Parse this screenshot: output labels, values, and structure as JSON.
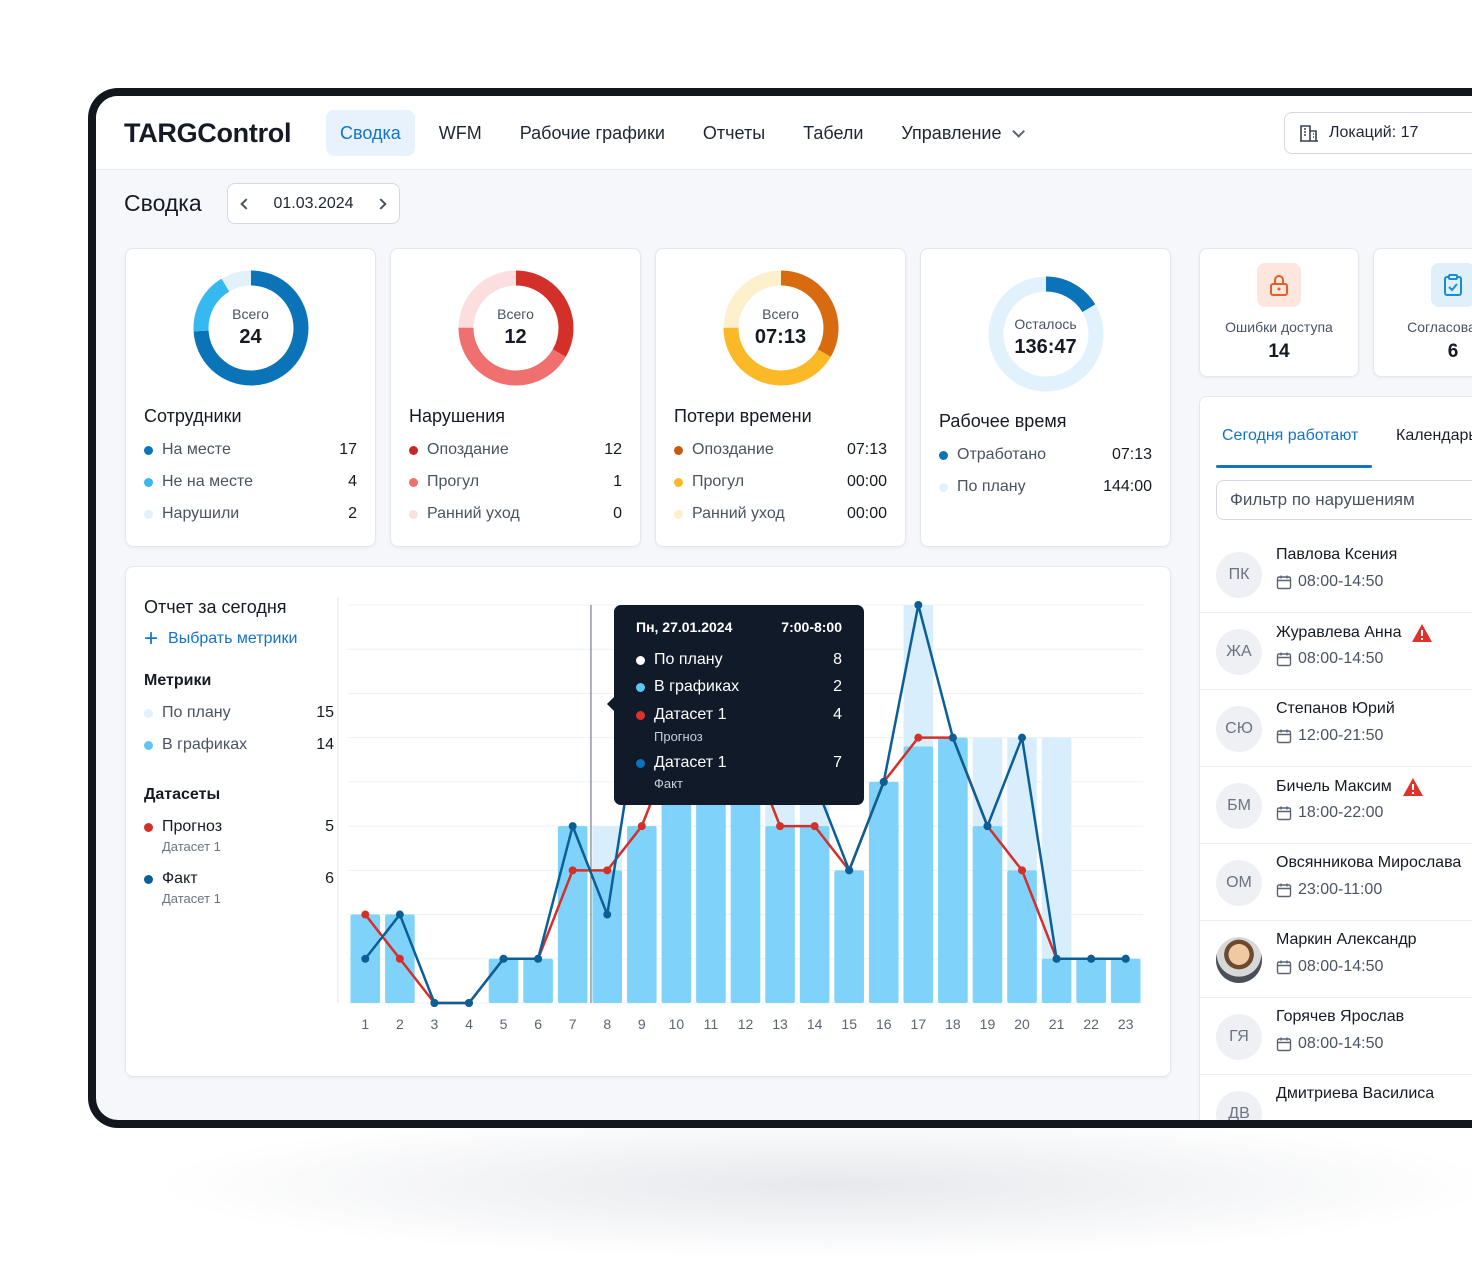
{
  "app": {
    "logo": "TARGControl"
  },
  "nav": [
    {
      "label": "Сводка",
      "active": true
    },
    {
      "label": "WFM"
    },
    {
      "label": "Рабочие графики"
    },
    {
      "label": "Отчеты"
    },
    {
      "label": "Табели"
    },
    {
      "label": "Управление",
      "dropdown": true
    }
  ],
  "location": {
    "label": "Локаций: 17",
    "icon": "building-icon"
  },
  "page": {
    "title": "Сводка",
    "date": "01.03.2024"
  },
  "cards": [
    {
      "title": "Сотрудники",
      "donut_caption": "Всего",
      "donut_value": "24",
      "segments": [
        {
          "value": 17,
          "color": "#0b73b8"
        },
        {
          "value": 4,
          "color": "#36b8f0"
        },
        {
          "value": 2,
          "color": "#e2f2fc"
        }
      ],
      "rows": [
        {
          "label": "На месте",
          "value": "17",
          "color": "#0b73b8"
        },
        {
          "label": "Не на месте",
          "value": "4",
          "color": "#36b8f0"
        },
        {
          "label": "Нарушили",
          "value": "2",
          "color": "#e2f2fc"
        }
      ]
    },
    {
      "title": "Нарушения",
      "donut_caption": "Всего",
      "donut_value": "12",
      "segments": [
        {
          "value": 4,
          "color": "#d4302a"
        },
        {
          "value": 5,
          "color": "#f07070"
        },
        {
          "value": 3,
          "color": "#fcdede"
        }
      ],
      "rows": [
        {
          "label": "Опоздание",
          "value": "12",
          "color": "#c42a24"
        },
        {
          "label": "Прогул",
          "value": "1",
          "color": "#f07070"
        },
        {
          "label": "Ранний уход",
          "value": "0",
          "color": "#fbe0e0"
        }
      ]
    },
    {
      "title": "Потери времени",
      "donut_caption": "Всего",
      "donut_value": "07:13",
      "segments": [
        {
          "value": 4,
          "color": "#d86a10"
        },
        {
          "value": 5,
          "color": "#fbb928"
        },
        {
          "value": 3,
          "color": "#fdf0cc"
        }
      ],
      "rows": [
        {
          "label": "Опоздание",
          "value": "07:13",
          "color": "#c85a0e"
        },
        {
          "label": "Прогул",
          "value": "00:00",
          "color": "#fbb928"
        },
        {
          "label": "Ранний уход",
          "value": "00:00",
          "color": "#fdf0c8"
        }
      ]
    },
    {
      "title": "Рабочее время",
      "donut_caption": "Осталось",
      "donut_value": "136:47",
      "segments": [
        {
          "value": 7.2,
          "color": "#0b73b8"
        },
        {
          "value": 36.8,
          "color": "#e2f2fc"
        }
      ],
      "rows": [
        {
          "label": "Отработано",
          "value": "07:13",
          "color": "#0b73b8"
        },
        {
          "label": "По плану",
          "value": "144:00",
          "color": "#e2f2fc"
        }
      ]
    }
  ],
  "mini_cards": [
    {
      "label": "Ошибки доступа",
      "value": "14",
      "icon": "lock-icon",
      "bg": "#fde6de",
      "fg": "#e0602a"
    },
    {
      "label": "Согласования",
      "value": "6",
      "icon": "clipboard-check-icon",
      "bg": "#dff0fb",
      "fg": "#1a8fd0"
    }
  ],
  "report": {
    "title": "Отчет за сегодня",
    "add_metrics": "Выбрать метрики",
    "metrics_header": "Метрики",
    "metrics": [
      {
        "label": "По плану",
        "value": "15",
        "color": "#e2f2fc"
      },
      {
        "label": "В графиках",
        "value": "14",
        "color": "#5ec6f4"
      }
    ],
    "datasets_header": "Датасеты",
    "datasets": [
      {
        "label": "Прогноз",
        "sub": "Датасет 1",
        "value": "5",
        "color": "#d4302a"
      },
      {
        "label": "Факт",
        "sub": "Датасет 1",
        "value": "6",
        "color": "#0b5f98"
      }
    ]
  },
  "chart_data": {
    "type": "bar",
    "categories": [
      "1",
      "2",
      "3",
      "4",
      "5",
      "6",
      "7",
      "8",
      "9",
      "10",
      "11",
      "12",
      "13",
      "14",
      "15",
      "16",
      "17",
      "18",
      "19",
      "20",
      "21",
      "22",
      "23"
    ],
    "ylim": [
      0,
      9
    ],
    "grid": true,
    "series": [
      {
        "name": "По плану",
        "type": "bar",
        "color": "#d8eefc",
        "values": [
          2,
          2,
          0,
          0,
          1,
          1,
          4,
          4,
          4,
          5,
          7,
          6,
          6,
          5,
          3,
          5,
          9,
          6,
          6,
          6,
          6,
          1,
          1
        ]
      },
      {
        "name": "В графиках",
        "type": "bar",
        "color": "#7fd3fa",
        "values": [
          2,
          2,
          0,
          0,
          1,
          1,
          4,
          3,
          4,
          6,
          6,
          6,
          4,
          4,
          3,
          5,
          5.8,
          6,
          4,
          3,
          1,
          1,
          1
        ]
      },
      {
        "name": "Прогноз",
        "type": "line",
        "color": "#d4302a",
        "values": [
          2,
          1,
          0,
          0,
          1,
          1,
          3,
          3,
          4,
          6,
          6,
          6,
          4,
          4,
          3,
          5,
          6,
          6,
          4,
          3,
          1,
          1,
          1
        ]
      },
      {
        "name": "Факт",
        "type": "line",
        "color": "#0b5f98",
        "values": [
          1,
          2,
          0,
          0,
          1,
          1,
          4,
          2,
          7,
          6,
          6,
          6,
          5,
          5,
          3,
          5,
          9,
          6,
          4,
          6,
          1,
          1,
          1
        ]
      }
    ]
  },
  "tooltip": {
    "date": "Пн, 27.01.2024",
    "range": "7:00-8:00",
    "rows": [
      {
        "label": "По плану",
        "value": "8",
        "color": "#ffffff"
      },
      {
        "label": "В графиках",
        "value": "2",
        "color": "#5ec6f4"
      },
      {
        "label": "Датасет 1",
        "sub": "Прогноз",
        "value": "4",
        "color": "#e0322b"
      },
      {
        "label": "Датасет 1",
        "sub": "Факт",
        "value": "7",
        "color": "#0b73b8"
      }
    ]
  },
  "tabs": [
    {
      "label": "Сегодня работают",
      "active": true
    },
    {
      "label": "Календарь"
    }
  ],
  "filter_placeholder": "Фильтр по нарушениям",
  "people": [
    {
      "initials": "ПК",
      "name": "Павлова Ксения",
      "time": "08:00-14:50",
      "warning": false
    },
    {
      "initials": "ЖА",
      "name": "Журавлева Анна",
      "time": "08:00-14:50",
      "warning": true
    },
    {
      "initials": "СЮ",
      "name": "Степанов Юрий",
      "time": "12:00-21:50",
      "warning": false
    },
    {
      "initials": "БМ",
      "name": "Бичель Максим",
      "time": "18:00-22:00",
      "warning": true
    },
    {
      "initials": "ОМ",
      "name": "Овсянникова Мирослава",
      "time": "23:00-11:00",
      "warning": false
    },
    {
      "initials": "",
      "name": "Маркин Александр",
      "time": "08:00-14:50",
      "warning": false,
      "photo": true
    },
    {
      "initials": "ГЯ",
      "name": "Горячев Ярослав",
      "time": "08:00-14:50",
      "warning": false
    },
    {
      "initials": "ДВ",
      "name": "Дмитриева Василиса",
      "time": "",
      "warning": false
    }
  ]
}
